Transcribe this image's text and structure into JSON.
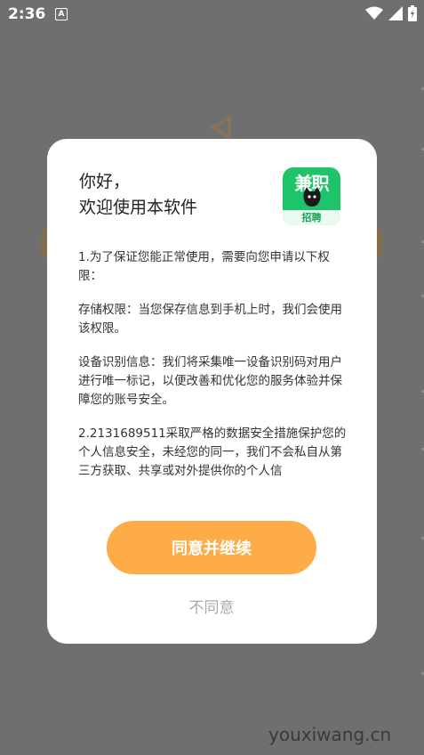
{
  "status_bar": {
    "time": "2:36",
    "a_badge": "A"
  },
  "dialog": {
    "greeting_line1": "你好，",
    "greeting_line2": "欢迎使用本软件",
    "logo_main_text": "兼职",
    "logo_sub_text": "招聘",
    "paragraphs": [
      "1.为了保证您能正常使用，需要向您申请以下权限：",
      "存储权限：当您保存信息到手机上时，我们会使用该权限。",
      "设备识别信息：我们将采集唯一设备识别码对用户进行唯一标记，以便改善和优化您的服务体验并保障您的账号安全。",
      "2.2131689511采取严格的数据安全措施保护您的个人信息安全，未经您的同一，我们不会私自从第三方获取、共享或对外提供你的个人信"
    ],
    "agree_label": "同意并继续",
    "disagree_label": "不同意"
  },
  "watermark": "youxiwang.cn",
  "colors": {
    "accent": "#fdac47",
    "logo_green": "#1fc46a",
    "overlay": "#6f6f6f"
  },
  "icons": [
    "wifi-icon",
    "signal-icon",
    "battery-icon",
    "cat-icon"
  ]
}
